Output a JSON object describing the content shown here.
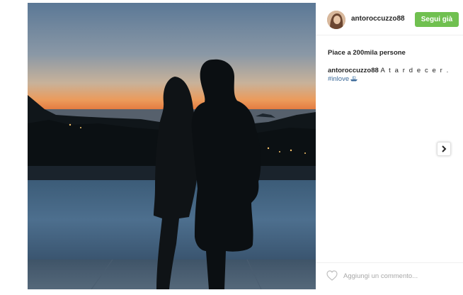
{
  "post": {
    "username": "antoroccuzzo88",
    "follow_label": "Segui già",
    "likes_text": "Piace a 200mila persone",
    "caption_user": "antoroccuzzo88",
    "caption_text": "A t a r d e c e r .",
    "hashtag": "#inlove",
    "hashtag_emoji": "boat-icon",
    "comment_placeholder": "Aggiungi un commento...",
    "next_icon": "chevron-right-icon",
    "like_icon": "heart-outline-icon"
  },
  "colors": {
    "follow_button": "#70c050",
    "hashtag": "#3d6b9a",
    "sky_top": "#5f7d9c",
    "sky_horizon": "#e2733a"
  }
}
